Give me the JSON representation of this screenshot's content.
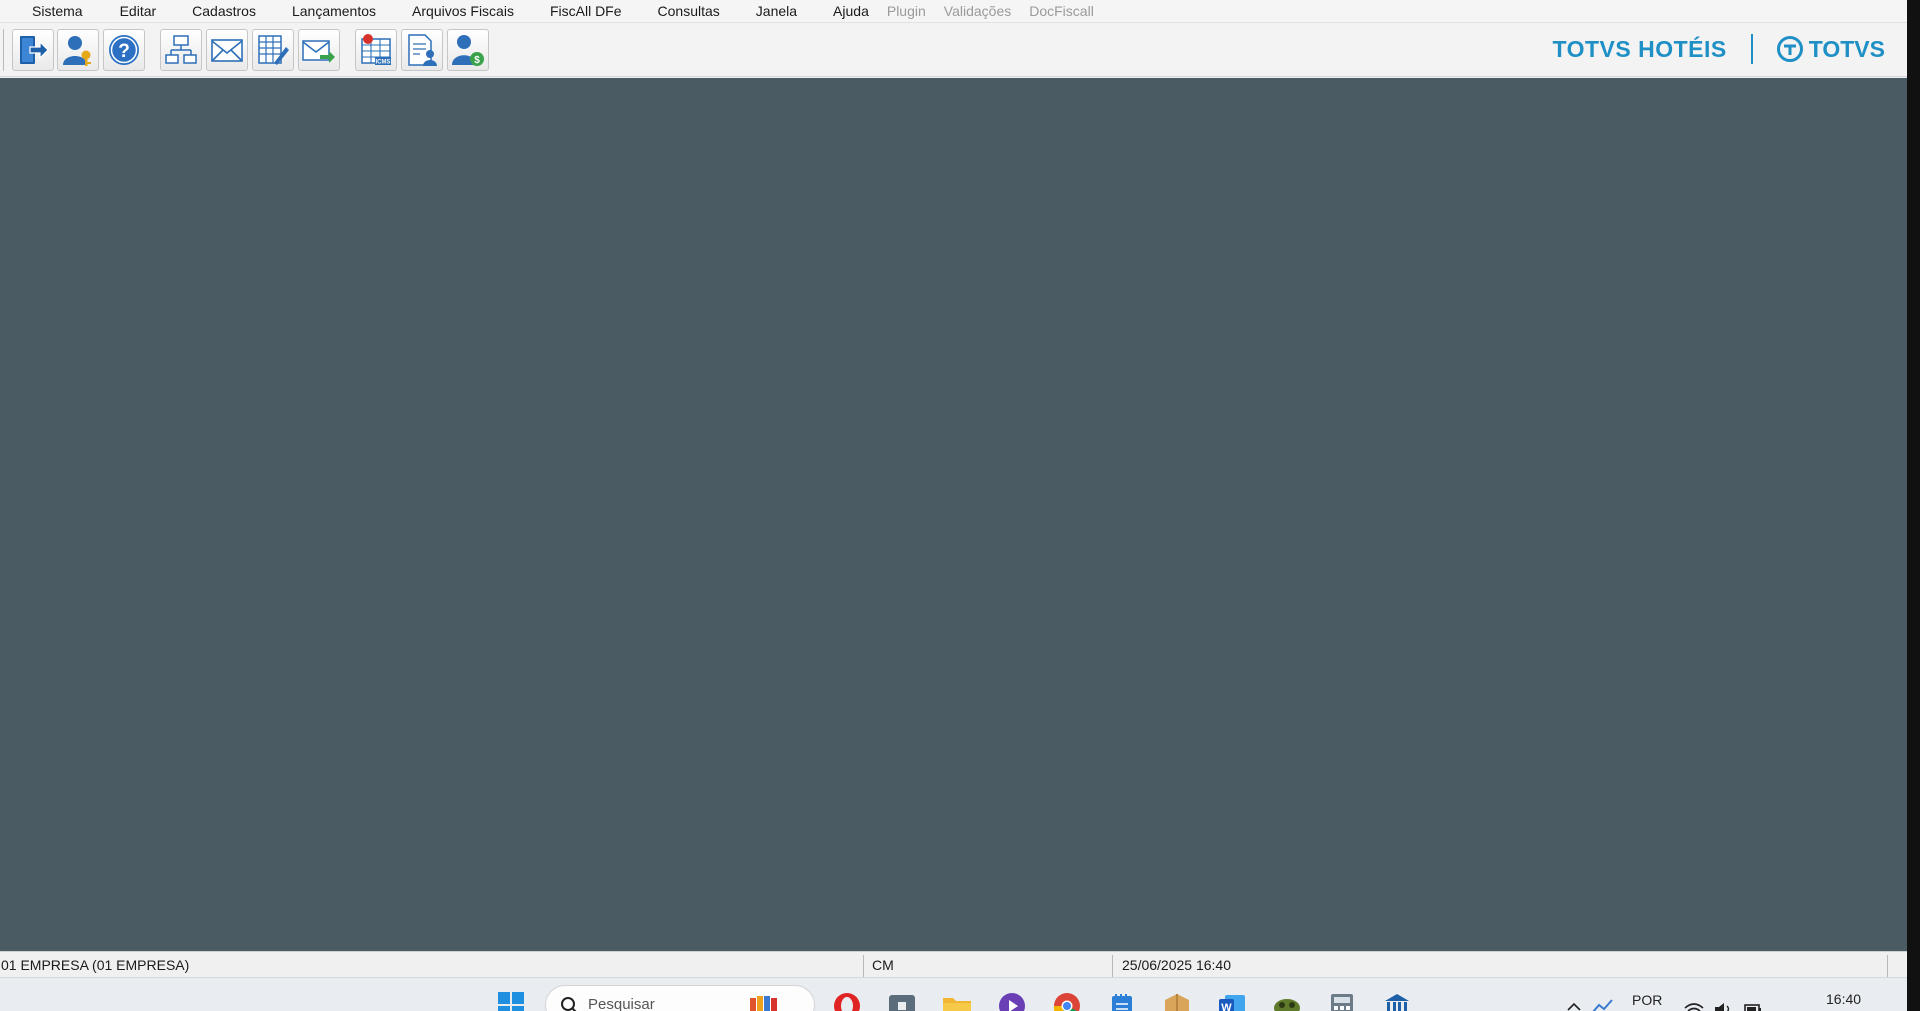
{
  "menu": {
    "items": [
      "Sistema",
      "Editar",
      "Cadastros",
      "Lançamentos",
      "Arquivos Fiscais",
      "FiscAll DFe",
      "Consultas",
      "Janela",
      "Ajuda"
    ],
    "disabled_items": [
      "Plugin",
      "Validações",
      "DocFiscall"
    ]
  },
  "toolbar": {
    "buttons": [
      "exit-icon",
      "user-key-icon",
      "help-icon",
      "network-icon",
      "mail-icon",
      "spreadsheet-edit-icon",
      "mail-send-icon",
      "icms-table-icon",
      "document-user-icon",
      "user-money-icon"
    ],
    "icms_label": "ICMS"
  },
  "brand": {
    "product": "TOTVS HOTÉIS",
    "company": "TOTVS",
    "color": "#1e90c6"
  },
  "workspace": {
    "color": "#4a5b63"
  },
  "statusbar": {
    "company": "01 EMPRESA (01 EMPRESA)",
    "user": "CM",
    "datetime": "25/06/2025 16:40"
  },
  "taskbar": {
    "search_placeholder": "Pesquisar",
    "language": "POR",
    "clock": "16:40",
    "apps": [
      "windows-start-icon",
      "crayons-icon",
      "opera-icon",
      "store-icon",
      "file-explorer-icon",
      "media-player-icon",
      "chrome-icon",
      "notepad-icon",
      "package-icon",
      "word-icon",
      "game-icon",
      "calculator-icon",
      "bank-icon"
    ]
  }
}
